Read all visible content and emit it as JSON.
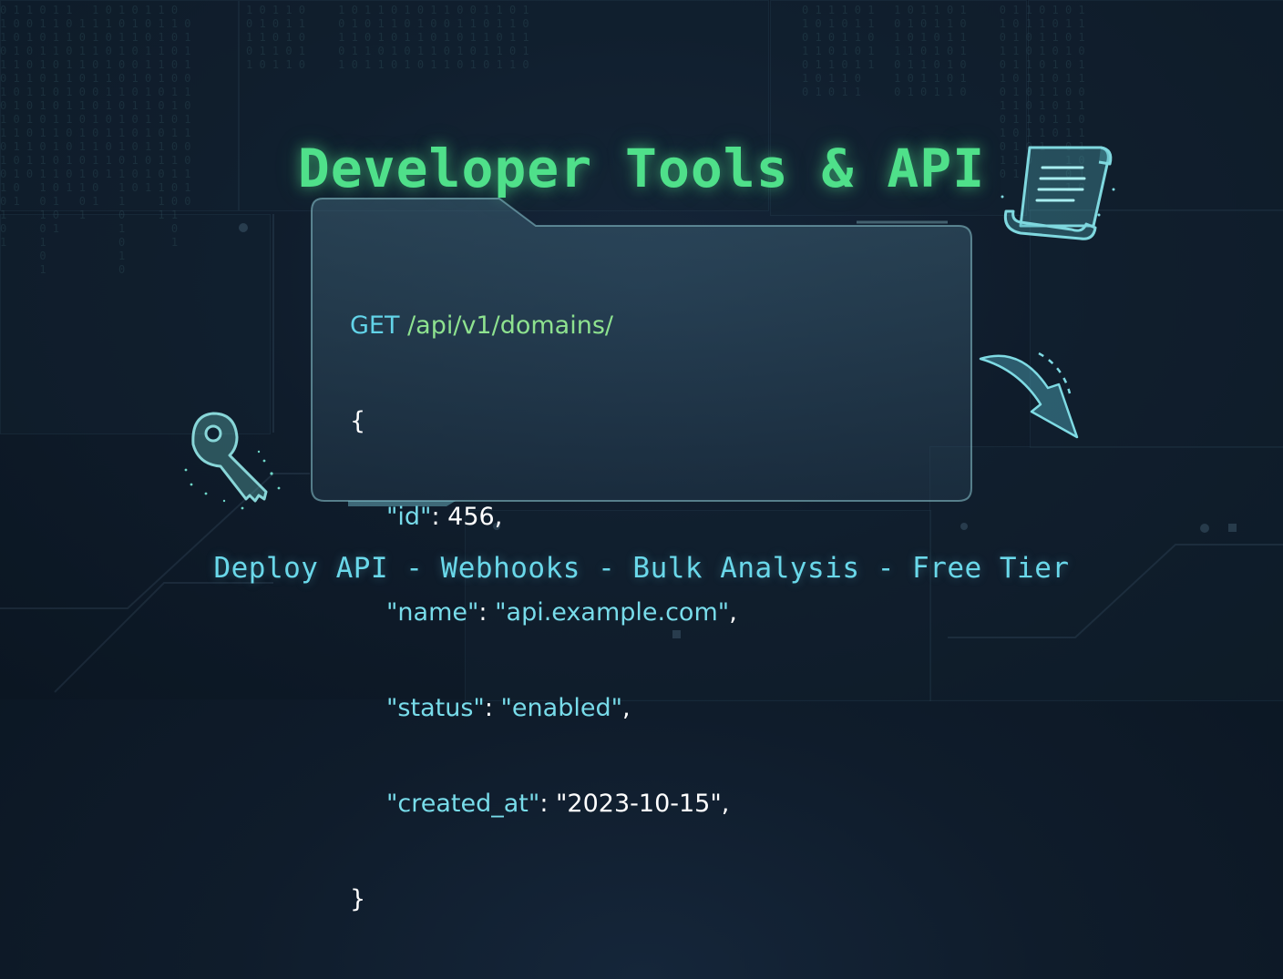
{
  "title": "Developer Tools & API",
  "request": {
    "method": "GET",
    "path": "/api/v1/domains/"
  },
  "json_body": {
    "open": "{",
    "close": "}",
    "fields": [
      {
        "key": "\"id\"",
        "value": "456",
        "type": "number",
        "trail": ","
      },
      {
        "key": "\"name\"",
        "value": "\"api.example.com\"",
        "type": "string",
        "trail": ","
      },
      {
        "key": "\"status\"",
        "value": "\"enabled\"",
        "type": "string",
        "trail": ","
      },
      {
        "key": "\"created_at\"",
        "value": "\"2023-10-15\"",
        "type": "string",
        "trail": ","
      }
    ]
  },
  "features": [
    "Deploy API",
    "Webhooks",
    "Bulk Analysis",
    "Free Tier"
  ],
  "features_separator": " - ",
  "icons": {
    "document": "scroll-document-icon",
    "arrow": "curved-arrow-icon",
    "key": "key-icon"
  },
  "colors": {
    "title": "#4fe08a",
    "accent": "#62d3e8",
    "path": "#8ee28f",
    "background": "#0f1c2b"
  }
}
